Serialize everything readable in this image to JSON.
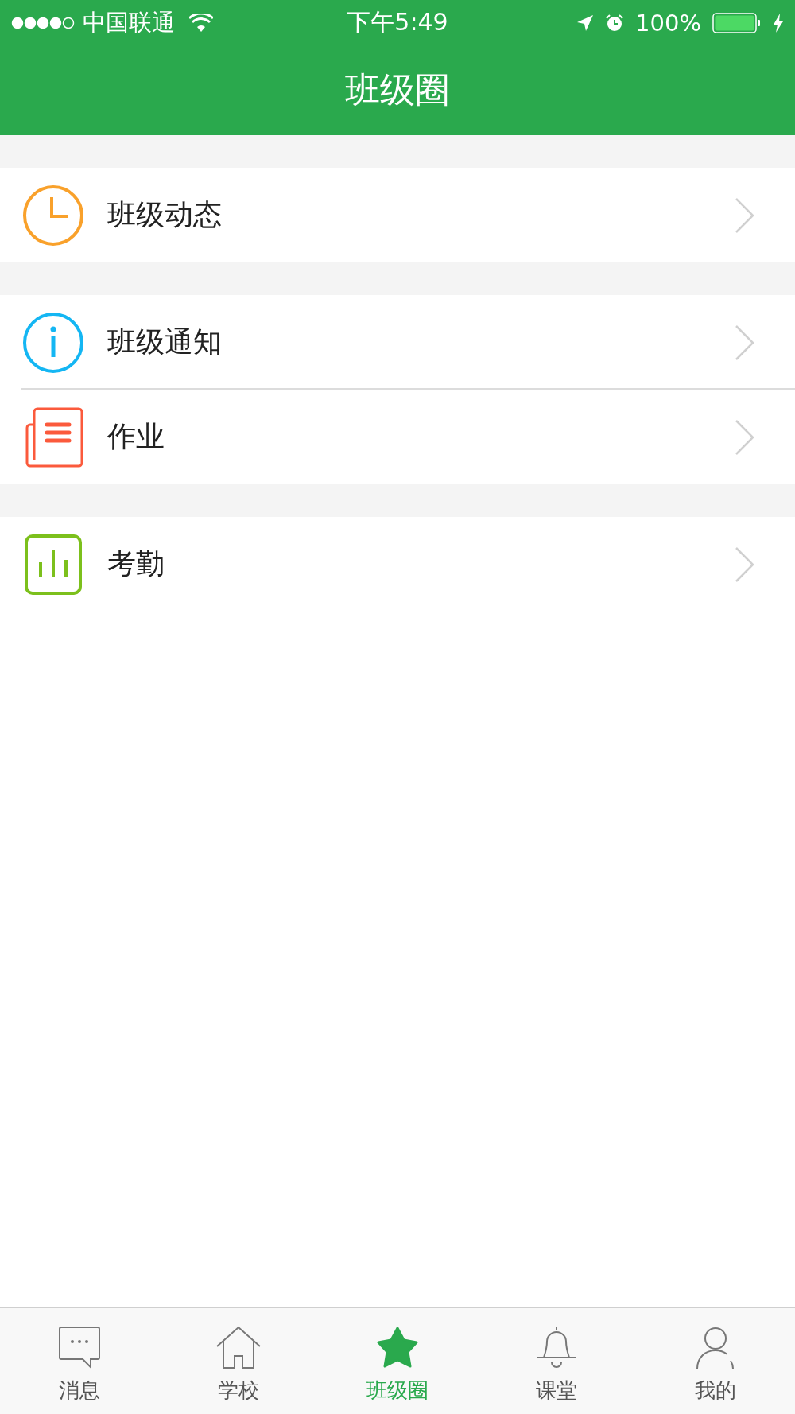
{
  "status_bar": {
    "carrier": "中国联通",
    "time": "下午5:49",
    "battery": "100%"
  },
  "nav_bar": {
    "title": "班级圈"
  },
  "sections": [
    {
      "items": [
        {
          "label": "班级动态",
          "kind": "clock"
        }
      ]
    },
    {
      "items": [
        {
          "label": "班级通知",
          "kind": "info"
        },
        {
          "label": "作业",
          "kind": "document"
        }
      ]
    },
    {
      "items": [
        {
          "label": "考勤",
          "kind": "chart"
        }
      ]
    }
  ],
  "tab_bar": [
    {
      "label": "消息",
      "kind": "message",
      "selected": false
    },
    {
      "label": "学校",
      "kind": "home",
      "selected": false
    },
    {
      "label": "班级圈",
      "kind": "star",
      "selected": true
    },
    {
      "label": "课堂",
      "kind": "bell",
      "selected": false
    },
    {
      "label": "我的",
      "kind": "person",
      "selected": false
    }
  ]
}
